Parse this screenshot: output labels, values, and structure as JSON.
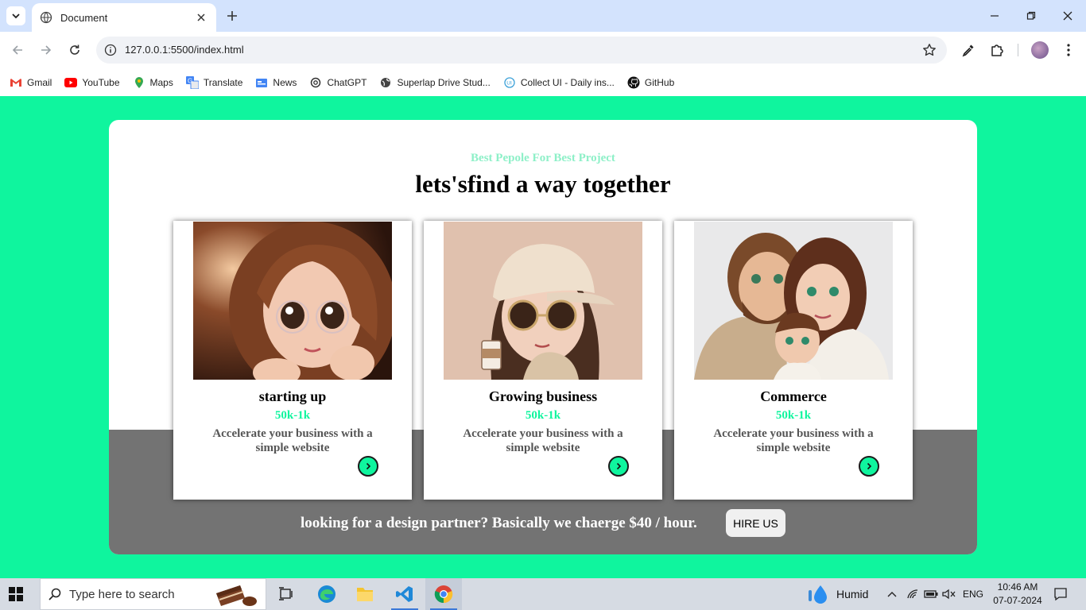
{
  "browser": {
    "tab_title": "Document",
    "url": "127.0.0.1:5500/index.html",
    "bookmarks": [
      {
        "label": "Gmail",
        "icon": "gmail-icon"
      },
      {
        "label": "YouTube",
        "icon": "youtube-icon"
      },
      {
        "label": "Maps",
        "icon": "maps-icon"
      },
      {
        "label": "Translate",
        "icon": "translate-icon"
      },
      {
        "label": "News",
        "icon": "news-icon"
      },
      {
        "label": "ChatGPT",
        "icon": "chatgpt-icon"
      },
      {
        "label": "Superlap Drive Stud...",
        "icon": "globe-icon"
      },
      {
        "label": "Collect UI - Daily ins...",
        "icon": "collectui-icon"
      },
      {
        "label": "GitHub",
        "icon": "github-icon"
      }
    ]
  },
  "page": {
    "subtitle": "Best Pepole For Best Project",
    "headline": "lets'sfind a way together",
    "cards": [
      {
        "title": "starting up",
        "price": "50k-1k",
        "description": "Accelerate your business with a simple website"
      },
      {
        "title": "Growing business",
        "price": "50k-1k",
        "description": "Accelerate your business with a simple website"
      },
      {
        "title": "Commerce",
        "price": "50k-1k",
        "description": "Accelerate your business with a simple website"
      }
    ],
    "footer_text": "looking for a design partner? Basically we chaerge $40 / hour.",
    "hire_label": "HIRE US",
    "colors": {
      "accent": "#0ff59e",
      "dark_band": "#737373"
    }
  },
  "taskbar": {
    "search_placeholder": "Type here to search",
    "weather": "Humid",
    "language": "ENG",
    "time": "10:46 AM",
    "date": "07-07-2024"
  }
}
